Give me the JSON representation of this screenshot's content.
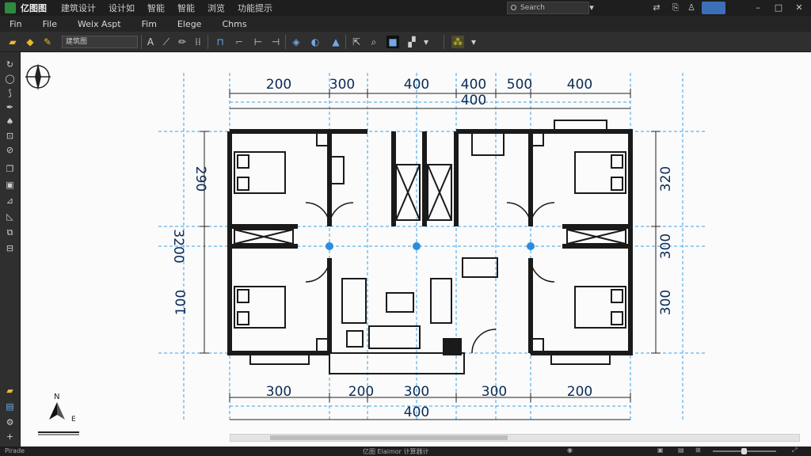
{
  "titlebar": {
    "app_name": "亿图图",
    "menus": [
      "建筑设计",
      "设计如",
      "智能",
      "智能",
      "浏览",
      "功能提示"
    ],
    "search_placeholder": "Search"
  },
  "menubar": {
    "items": [
      "Fin",
      "File",
      "Weix Aspt",
      "Fim",
      "Elege",
      "Chms"
    ]
  },
  "toolbar": {
    "select_value": "建筑图",
    "dropdown_arrow": "▾"
  },
  "canvas": {
    "top_dims_row1": [
      "200",
      "300",
      "400",
      "400",
      "500",
      "400"
    ],
    "top_dims_row2": [
      "400"
    ],
    "bottom_dims_row1": [
      "300",
      "200",
      "300",
      "300",
      "200"
    ],
    "bottom_dims_row2": [
      "400"
    ],
    "left_dims": [
      "290",
      "3200",
      "100"
    ],
    "right_dims": [
      "320",
      "300",
      "300"
    ],
    "compass_n": "N",
    "compass_e": "E"
  },
  "statusbar": {
    "left_text": "Pirade",
    "center_text": "亿图 Elaimor 计算器计"
  },
  "colors": {
    "accent_blue": "#2b8de0",
    "wall": "#1a1a1a",
    "grid_line": "#3aa0e8"
  }
}
